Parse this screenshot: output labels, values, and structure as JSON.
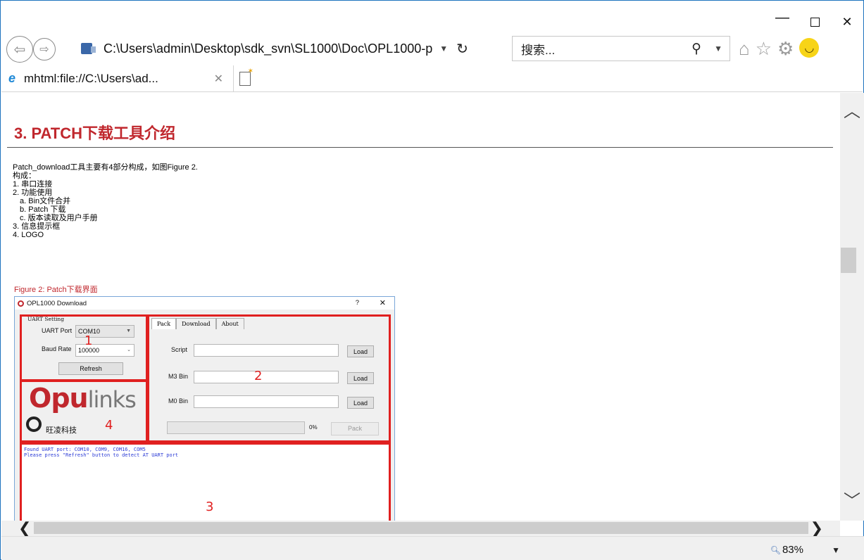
{
  "browser": {
    "address": "C:\\Users\\admin\\Desktop\\sdk_svn\\SL1000\\Doc\\OPL1000-p",
    "search_placeholder": "搜索...",
    "tab_title": "mhtml:file://C:\\Users\\ad...",
    "zoom": "83%"
  },
  "doc": {
    "heading": "3.   PATCH下载工具介绍",
    "para1": "Patch_download工具主要有4部分构成，如图Figure 2.",
    "para2": "构成：",
    "list": [
      {
        "label": "1.   串口连接",
        "level": 1
      },
      {
        "label": "2.   功能使用",
        "level": 1
      },
      {
        "label": "a.   Bin文件合并",
        "level": 2
      },
      {
        "label": "b.   Patch 下载",
        "level": 2
      },
      {
        "label": "c.   版本读取及用户手册",
        "level": 2
      },
      {
        "label": "3.   信息提示框",
        "level": 1
      },
      {
        "label": "4.   LOGO",
        "level": 1
      }
    ],
    "figure_caption": "Figure 2: Patch下载界面"
  },
  "app": {
    "title": "OPL1000 Download",
    "help": "?",
    "close": "✕",
    "uart_group": "UART Setting",
    "uart_port_label": "UART Port",
    "uart_port_value": "COM10",
    "baud_label": "Baud Rate",
    "baud_value": "100000",
    "refresh": "Refresh",
    "tabs": [
      "Pack",
      "Download",
      "About"
    ],
    "script_label": "Script",
    "m3_label": "M3 Bin",
    "m0_label": "M0 Bin",
    "load": "Load",
    "progress_pct": "0%",
    "progress_value": 0,
    "pack": "Pack",
    "logo_main1": "pu",
    "logo_main2": "links",
    "logo_cn": "旺凌科技",
    "log_line1": "Found UART port: COM10, COM9, COM16, COM5",
    "log_line2": "Please press \"Refresh\" button to detect AT UART port",
    "callouts": [
      "1",
      "2",
      "3",
      "4"
    ]
  },
  "colors": {
    "heading_red": "#c0272d",
    "callout_red": "#e02020",
    "log_blue": "#2b3bd6"
  }
}
